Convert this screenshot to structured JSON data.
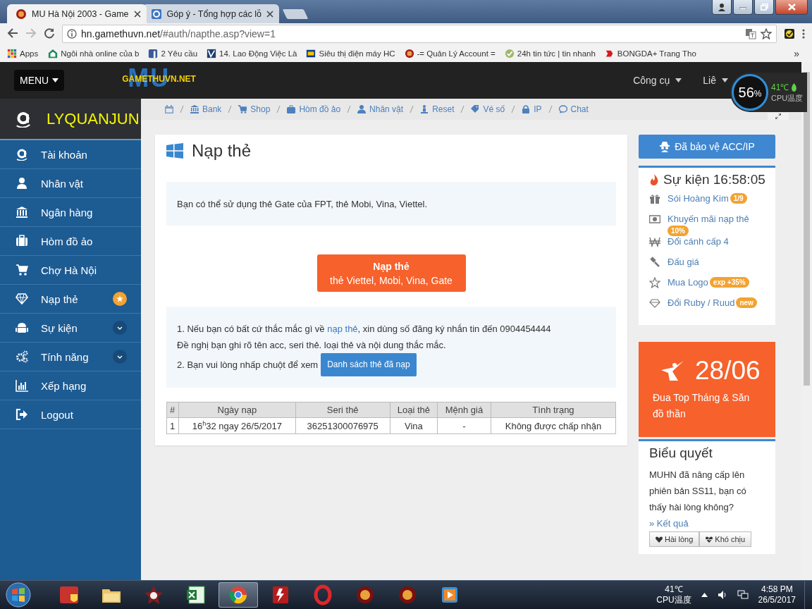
{
  "browser": {
    "tabs": [
      {
        "title": "MU Hà Nội 2003 - Game",
        "selected": true
      },
      {
        "title": "Góp ý - Tổng hợp các lỗ",
        "selected": false
      }
    ],
    "url_host": "hn.gamethuvn.net",
    "url_path": "/#auth/napthe.asp?view=1",
    "bookmarks": [
      "Apps",
      "Ngôi nhà online của b",
      "2 Yêu cầu",
      "14. Lao Động Việc Là",
      "Siêu thị điện máy HC",
      "-= Quản Lý Account =",
      "24h tin tức | tin nhanh",
      "BONGDA+ Trang Tho"
    ],
    "more": "»"
  },
  "header": {
    "menu": "MENU",
    "logo_mark": "MU",
    "logo": "GAMETHUVN.NET",
    "nav": [
      "Công cụ",
      "Liê"
    ]
  },
  "cpu_widget": {
    "percent": "56",
    "unit": "%",
    "temp": "41℃",
    "label": "CPU温度"
  },
  "sidebar": {
    "user": "LYQUANJUN",
    "items": [
      {
        "label": "Tài khoản",
        "kind": "plain"
      },
      {
        "label": "Nhân vật",
        "kind": "plain"
      },
      {
        "label": "Ngân hàng",
        "kind": "plain"
      },
      {
        "label": "Hòm đồ ảo",
        "kind": "plain"
      },
      {
        "label": "Chợ Hà Nội",
        "kind": "plain"
      },
      {
        "label": "Nạp thẻ",
        "kind": "star"
      },
      {
        "label": "Sự kiện",
        "kind": "expand"
      },
      {
        "label": "Tính năng",
        "kind": "expand"
      },
      {
        "label": "Xếp hạng",
        "kind": "plain"
      },
      {
        "label": "Logout",
        "kind": "plain"
      }
    ]
  },
  "breadcrumb": [
    "Bank",
    "Shop",
    "Hòm đồ ảo",
    "Nhân vật",
    "Reset",
    "Vé số",
    "IP",
    "Chat"
  ],
  "main": {
    "title": "Nạp thẻ",
    "info": "Bạn có thể sử dụng thẻ Gate của FPT, thẻ Mobi, Vina, Viettel.",
    "recharge_button": {
      "title": "Nạp thẻ",
      "subtitle": "thẻ Viettel, Mobi, Vina, Gate"
    },
    "notes": {
      "line_1_before": "1. Nếu bạn có bất cứ thắc mắc gì về ",
      "line_1_link": "nạp thẻ",
      "line_1_after": ", xin dùng số đăng ký nhắn tin đến 0904454444",
      "line_2": "Đề nghị bạn ghi rõ tên acc, seri thẻ. loại thẻ và nội dung thắc mắc.",
      "line_3": "2. Bạn vui lòng nhấp chuột để xem",
      "list_button": "Danh sách thẻ đã nạp"
    },
    "table": {
      "columns": [
        "#",
        "Ngày nạp",
        "Seri thẻ",
        "Loại thẻ",
        "Mệnh giá",
        "Tình trạng"
      ],
      "rows": [
        [
          "1",
          "16$^{h}$32 ngay 26/5/2017",
          "36251300076975",
          "Vina",
          "-",
          "Không được chấp nhận"
        ]
      ]
    }
  },
  "right": {
    "protect_button": "Đã bảo vệ ACC/IP",
    "events": {
      "title": "Sự kiện 16:58:05",
      "items": [
        {
          "label": "Sói Hoàng Kim",
          "badge": "1/9"
        },
        {
          "label": "Khuyến mãi nạp thẻ",
          "badge": "10%"
        },
        {
          "label": "Đổi cánh cấp 4"
        },
        {
          "label": "Đấu giá"
        },
        {
          "label": "Mua Logo",
          "badge": "exp +35%"
        },
        {
          "label": "Đổi Ruby / Ruud",
          "badge": "new"
        }
      ]
    },
    "promo": {
      "date": "28/06",
      "text": "Đua Top Tháng & Săn đồ thần"
    },
    "poll": {
      "title": "Biểu quyết",
      "text": "MUHN đã nâng cấp lên phiên bản SS11, bạn có thấy hài lòng không?",
      "link": "» Kết quả",
      "buttons": [
        "Hài lòng",
        "Khó chịu"
      ]
    }
  },
  "taskbar": {
    "apps": [
      {
        "selected": false
      },
      {
        "selected": false
      },
      {
        "selected": false
      },
      {
        "selected": false
      },
      {
        "selected": true
      },
      {
        "selected": false
      },
      {
        "selected": false
      },
      {
        "selected": false
      },
      {
        "selected": false
      },
      {
        "selected": false
      }
    ],
    "tray_temp": "41℃",
    "tray_label": "CPU温度",
    "time": "4:58 PM",
    "date": "26/5/2017"
  }
}
